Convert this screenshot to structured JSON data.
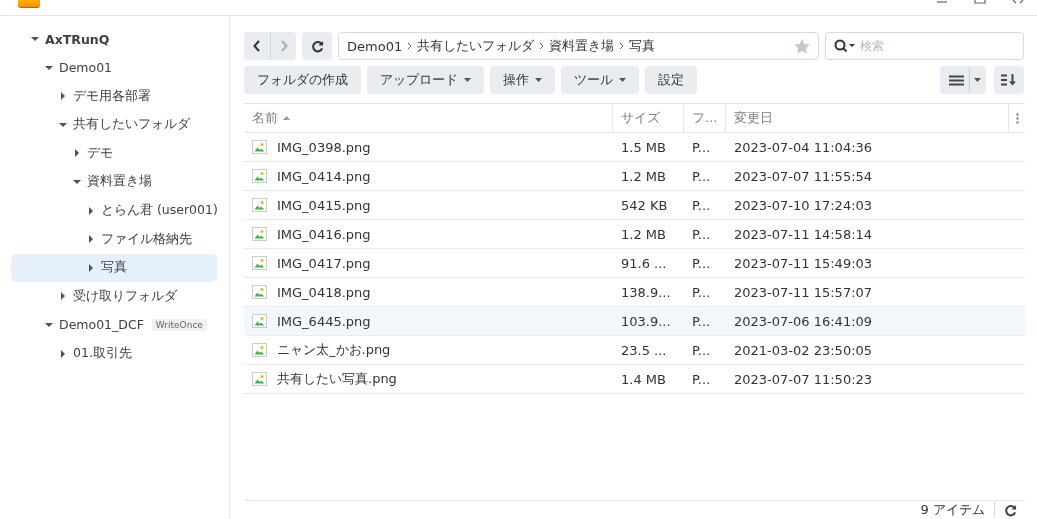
{
  "tree": [
    {
      "label": "AxTRunQ",
      "expanded": true,
      "selected": false,
      "children": [
        {
          "label": "Demo01",
          "expanded": true,
          "selected": false,
          "children": [
            {
              "label": "デモ用各部署",
              "expanded": false,
              "selected": false
            },
            {
              "label": "共有したいフォルダ",
              "expanded": true,
              "selected": false,
              "children": [
                {
                  "label": "デモ",
                  "expanded": false,
                  "selected": false
                },
                {
                  "label": "資料置き場",
                  "expanded": true,
                  "selected": false,
                  "children": [
                    {
                      "label": "とらん君 (user001)",
                      "expanded": false,
                      "selected": false
                    },
                    {
                      "label": "ファイル格納先",
                      "expanded": false,
                      "selected": false
                    },
                    {
                      "label": "写真",
                      "expanded": false,
                      "selected": true
                    }
                  ]
                }
              ]
            },
            {
              "label": "受け取りフォルダ",
              "expanded": false,
              "selected": false
            }
          ]
        },
        {
          "label": "Demo01_DCF",
          "badge": "WriteOnce",
          "expanded": true,
          "selected": false,
          "children": [
            {
              "label": "01.取引先",
              "expanded": false,
              "selected": false
            }
          ]
        }
      ]
    }
  ],
  "breadcrumb": [
    "Demo01",
    "共有したいフォルダ",
    "資料置き場",
    "写真"
  ],
  "search": {
    "placeholder": "検索"
  },
  "toolbar": [
    {
      "label": "フォルダの作成",
      "dropdown": false
    },
    {
      "label": "アップロード",
      "dropdown": true
    },
    {
      "label": "操作",
      "dropdown": true
    },
    {
      "label": "ツール",
      "dropdown": true
    },
    {
      "label": "設定",
      "dropdown": false
    }
  ],
  "table": {
    "columns": [
      "名前",
      "サイズ",
      "フ...",
      "変更日"
    ],
    "rows": [
      {
        "name": "IMG_0398.png",
        "size": "1.5 MB",
        "type": "P...",
        "modified": "2023-07-04 11:04:36",
        "selected": false
      },
      {
        "name": "IMG_0414.png",
        "size": "1.2 MB",
        "type": "P...",
        "modified": "2023-07-07 11:55:54",
        "selected": false
      },
      {
        "name": "IMG_0415.png",
        "size": "542 KB",
        "type": "P...",
        "modified": "2023-07-10 17:24:03",
        "selected": false
      },
      {
        "name": "IMG_0416.png",
        "size": "1.2 MB",
        "type": "P...",
        "modified": "2023-07-11 14:58:14",
        "selected": false
      },
      {
        "name": "IMG_0417.png",
        "size": "91.6 ...",
        "type": "P...",
        "modified": "2023-07-11 15:49:03",
        "selected": false
      },
      {
        "name": "IMG_0418.png",
        "size": "138.9...",
        "type": "P...",
        "modified": "2023-07-11 15:57:07",
        "selected": false
      },
      {
        "name": "IMG_6445.png",
        "size": "103.9...",
        "type": "P...",
        "modified": "2023-07-06 16:41:09",
        "selected": true
      },
      {
        "name": "ニャン太_かお.png",
        "size": "23.5 ...",
        "type": "P...",
        "modified": "2021-03-02 23:50:05",
        "selected": false
      },
      {
        "name": "共有したい写真.png",
        "size": "1.4 MB",
        "type": "P...",
        "modified": "2023-07-07 11:50:23",
        "selected": false
      }
    ]
  },
  "status_bar": {
    "count": "9 アイテム"
  }
}
